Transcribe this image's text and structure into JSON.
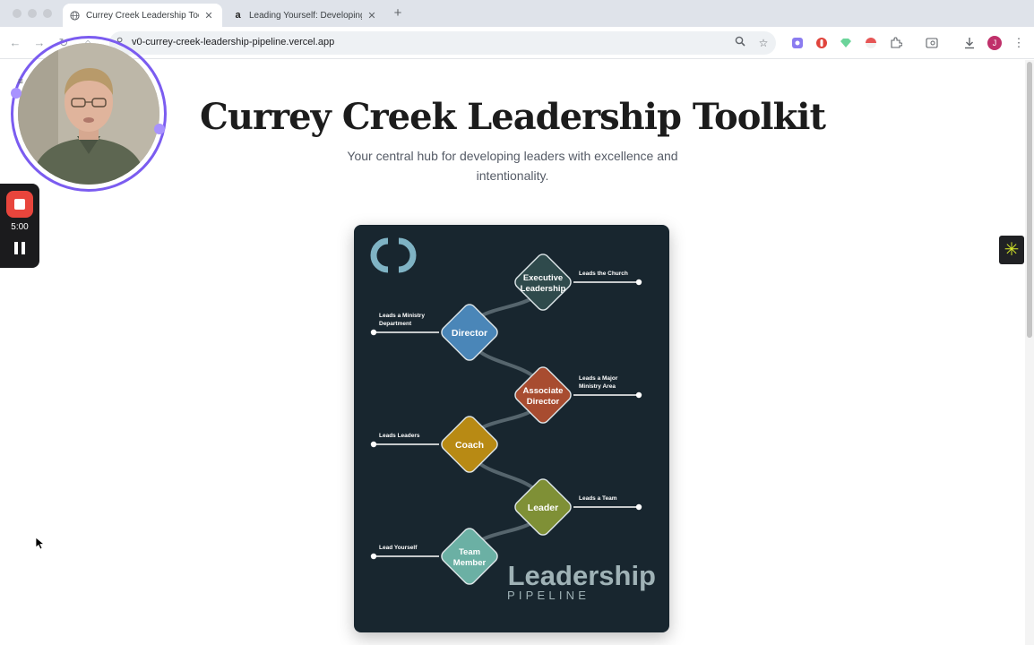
{
  "browser": {
    "tabs": [
      {
        "title": "Currey Creek Leadership Too",
        "active": true,
        "icon": "globe-icon"
      },
      {
        "title": "Leading Yourself: Developing",
        "active": false,
        "icon": "amazon-icon"
      }
    ],
    "new_tab_label": "+",
    "url": "v0-currey-creek-leadership-pipeline.vercel.app",
    "profile_initial": "J"
  },
  "page": {
    "title": "Currey Creek Leadership Toolkit",
    "subtitle": "Your central hub for developing leaders with excellence and intentionality."
  },
  "pipeline": {
    "brand": "Leadership",
    "brand_sub": "PIPELINE",
    "nodes": [
      {
        "id": "exec",
        "label_lines": [
          "Executive",
          "Leadership"
        ],
        "desc_lines": [
          "Leads the Church"
        ],
        "color": "#2f4a4c",
        "side": "right"
      },
      {
        "id": "director",
        "label_lines": [
          "Director"
        ],
        "desc_lines": [
          "Leads a Ministry",
          "Department"
        ],
        "color": "#4a86b8",
        "side": "left"
      },
      {
        "id": "assoc",
        "label_lines": [
          "Associate",
          "Director"
        ],
        "desc_lines": [
          "Leads a Major",
          "Ministry Area"
        ],
        "color": "#a84c30",
        "side": "right"
      },
      {
        "id": "coach",
        "label_lines": [
          "Coach"
        ],
        "desc_lines": [
          "Leads Leaders"
        ],
        "color": "#b88a14",
        "side": "left"
      },
      {
        "id": "leader",
        "label_lines": [
          "Leader"
        ],
        "desc_lines": [
          "Leads a Team"
        ],
        "color": "#7f9036",
        "side": "right"
      },
      {
        "id": "member",
        "label_lines": [
          "Team",
          "Member"
        ],
        "desc_lines": [
          "Lead Yourself"
        ],
        "color": "#6bb0a4",
        "side": "left"
      }
    ]
  },
  "recorder": {
    "timer": "5:00"
  },
  "colors": {
    "accent": "#7b5cf0",
    "record": "#e8453c",
    "card_bg": "#18262f"
  }
}
